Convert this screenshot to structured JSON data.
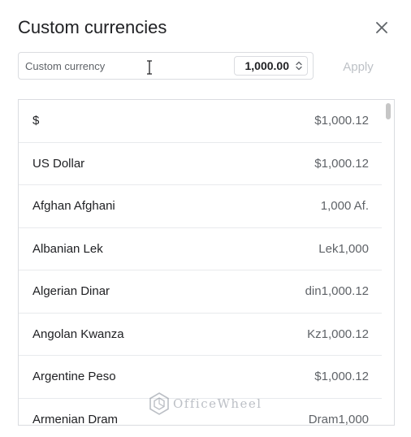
{
  "dialog": {
    "title": "Custom currencies",
    "close_icon": "close-icon"
  },
  "input": {
    "placeholder": "Custom currency",
    "value": ""
  },
  "stepper": {
    "value": "1,000.00",
    "icon": "up-down-arrows-icon"
  },
  "apply_label": "Apply",
  "currencies": [
    {
      "name": "$",
      "value": "$1,000.12"
    },
    {
      "name": "US Dollar",
      "value": "$1,000.12"
    },
    {
      "name": "Afghan Afghani",
      "value": "1,000 Af."
    },
    {
      "name": "Albanian Lek",
      "value": "Lek1,000"
    },
    {
      "name": "Algerian Dinar",
      "value": "din1,000.12"
    },
    {
      "name": "Angolan Kwanza",
      "value": "Kz1,000.12"
    },
    {
      "name": "Argentine Peso",
      "value": "$1,000.12"
    },
    {
      "name": "Armenian Dram",
      "value": "Dram1,000"
    }
  ],
  "watermark": {
    "text": "OfficeWheel",
    "icon": "officewheel-logo-icon"
  },
  "colors": {
    "border": "#dadce0",
    "text": "#202124",
    "muted": "#5f6368",
    "disabled": "#bdc1c6"
  }
}
